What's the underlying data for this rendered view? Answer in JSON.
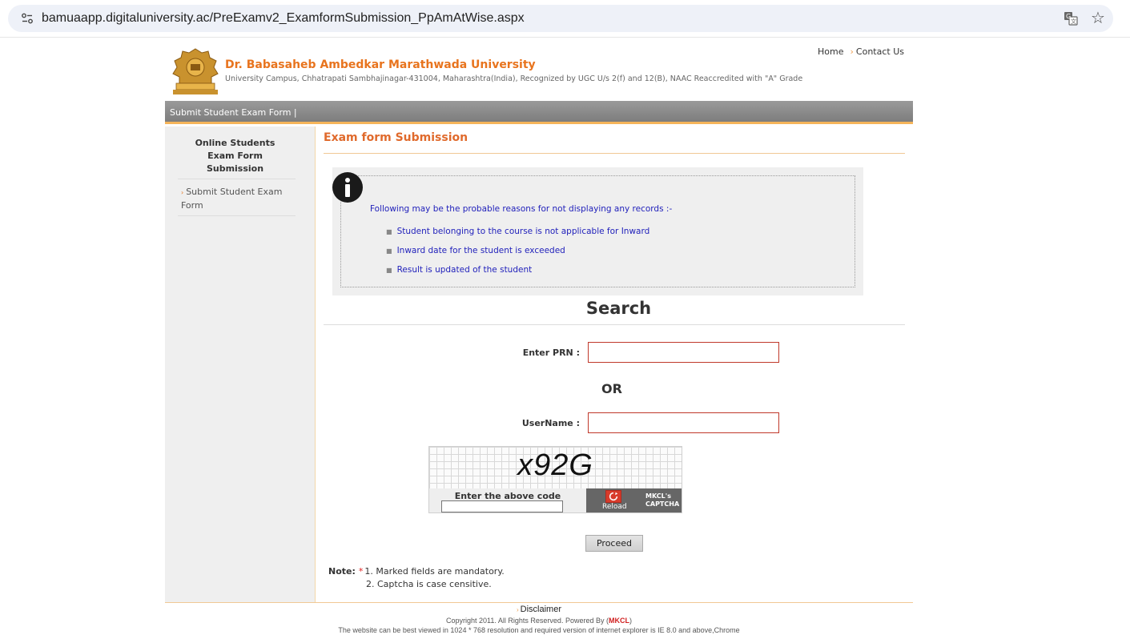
{
  "browser": {
    "url": "bamuaapp.digitaluniversity.ac/PreExamv2_ExamformSubmission_PpAmAtWise.aspx",
    "site_icon": "site-settings-icon",
    "translate_icon": "translate-icon",
    "bookmark_icon": "star-icon",
    "bookmark_glyph": "☆"
  },
  "header": {
    "links": [
      "Home",
      "Contact Us"
    ],
    "university_name": "Dr. Babasaheb Ambedkar Marathwada University",
    "address": "University Campus, Chhatrapati Sambhajinagar-431004, Maharashtra(India), Recognized by UGC U/s 2(f) and 12(B), NAAC Reaccredited with \"A\" Grade"
  },
  "nav": {
    "item": "Submit Student Exam Form |"
  },
  "sidebar": {
    "title": "Online Students Exam Form Submission",
    "link": "Submit Student Exam Form"
  },
  "main": {
    "title": "Exam form Submission",
    "info_lead": "Following may be the probable reasons for not displaying any records :-",
    "reasons": [
      "Student belonging to the course is not applicable for Inward",
      "Inward date for the student is exceeded",
      "Result is updated of the student"
    ],
    "search_heading": "Search",
    "prn_label": "Enter PRN :",
    "prn_value": "",
    "or_text": "OR",
    "username_label": "UserName :",
    "username_value": "",
    "captcha": {
      "code": "x92G",
      "label": "Enter the above code",
      "reload": "Reload",
      "brand": "MKCL's CAPTCHA"
    },
    "proceed": "Proceed",
    "note_label": "Note:",
    "note_star": "*",
    "notes": [
      "1. Marked fields are mandatory.",
      "2. Captcha is case censitive."
    ]
  },
  "footer": {
    "disclaimer": "Disclaimer",
    "copyright_prefix": "Copyright 2011. All Rights Reserved. Powered By (",
    "copyright_brand": "MKCL",
    "copyright_suffix": ")",
    "resolution_note": "The website can be best viewed in 1024 * 768 resolution and required version of internet explorer is IE 8.0 and above,Chrome"
  },
  "colors": {
    "accent": "#e8741e",
    "nav_bg": "#8a8a8a",
    "link_blue": "#2222bb",
    "input_border": "#c0392b"
  }
}
